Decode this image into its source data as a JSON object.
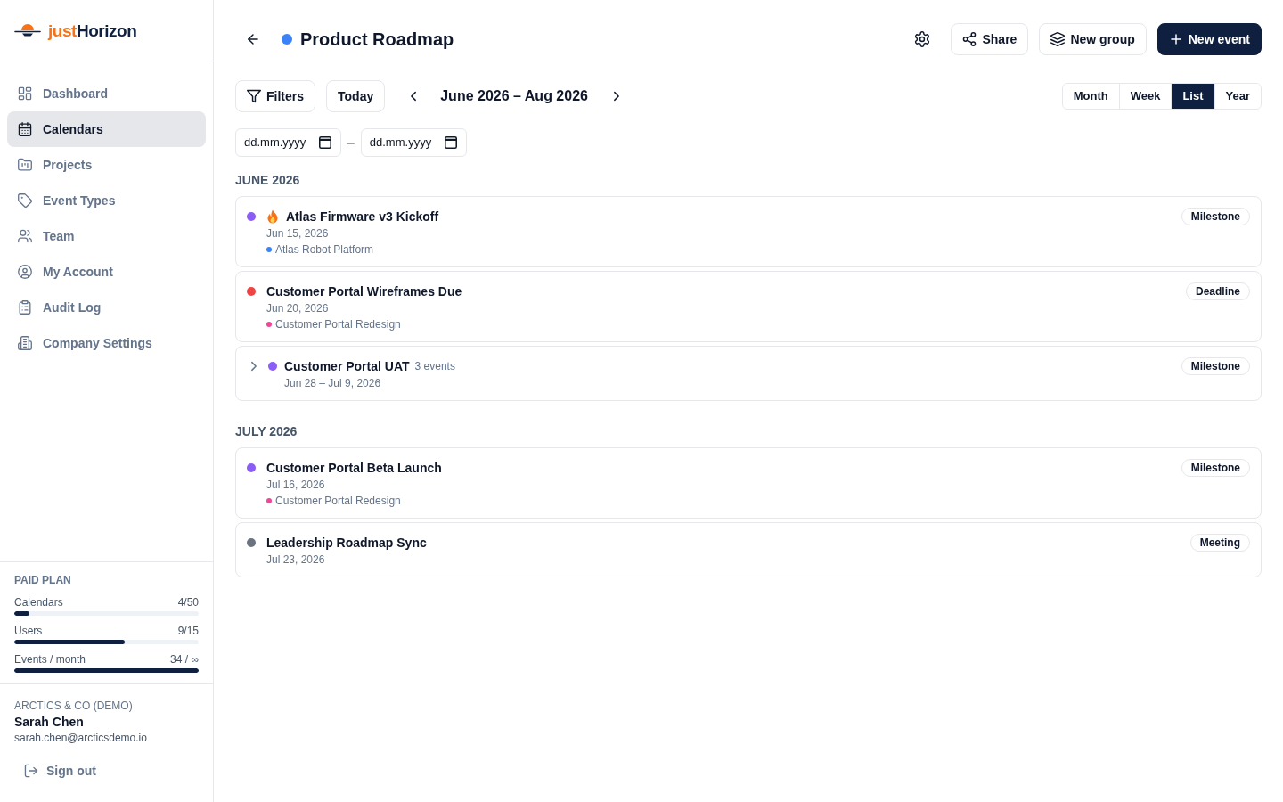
{
  "sidebar": {
    "logo": {
      "prefix": "just",
      "name": "Horizon"
    },
    "nav": [
      {
        "label": "Dashboard",
        "selected": false
      },
      {
        "label": "Calendars",
        "selected": true
      },
      {
        "label": "Projects",
        "selected": false
      },
      {
        "label": "Event Types",
        "selected": false
      },
      {
        "label": "Team",
        "selected": false
      },
      {
        "label": "My Account",
        "selected": false
      },
      {
        "label": "Audit Log",
        "selected": false
      },
      {
        "label": "Company Settings",
        "selected": false
      }
    ],
    "plan": {
      "title": "PAID PLAN",
      "meters": [
        {
          "label": "Calendars",
          "reading": "4/50",
          "level": 0.08
        },
        {
          "label": "Users",
          "reading": "9/15",
          "level": 0.6
        },
        {
          "label": "Events / month",
          "reading": "34 / ∞",
          "level": 1
        }
      ]
    },
    "account": {
      "organization": "ARCTICS & CO (DEMO)",
      "name": "Sarah Chen",
      "email": "sarah.chen@arcticsdemo.io",
      "sign_out": "Sign out"
    }
  },
  "header": {
    "title": "Product Roadmap",
    "buttons": [
      {
        "label": "Share",
        "primary": false
      },
      {
        "label": "New group",
        "primary": false
      },
      {
        "label": "New event",
        "primary": true
      }
    ]
  },
  "toolbar": {
    "filters": "Filters",
    "today": "Today",
    "range": "June 2026 – Aug 2026",
    "views": [
      {
        "label": "Month",
        "selected": false
      },
      {
        "label": "Week",
        "selected": false
      },
      {
        "label": "List",
        "selected": true
      },
      {
        "label": "Year",
        "selected": false
      }
    ]
  },
  "date_range": {
    "from": {
      "placeholder": "dd.mm.yyyy"
    },
    "separator": "–",
    "to": {
      "placeholder": "dd.mm.yyyy"
    }
  },
  "sections": [
    {
      "heading": "JUNE 2026",
      "events": [
        {
          "kind": "event",
          "title": "Atlas Firmware v3 Kickoff",
          "priority": true,
          "color": "#8b5cf6",
          "date": "Jun 15, 2026",
          "project": {
            "name": "Atlas Robot Platform",
            "color": "#3b82f6"
          },
          "badge": "Milestone"
        },
        {
          "kind": "event",
          "title": "Customer Portal Wireframes Due",
          "priority": false,
          "color": "#ef4444",
          "date": "Jun 20, 2026",
          "project": {
            "name": "Customer Portal Redesign",
            "color": "#ec4899"
          },
          "badge": "Deadline"
        },
        {
          "kind": "group",
          "title": "Customer Portal UAT",
          "priority": false,
          "expanded": false,
          "count": "3 events",
          "color": "#8b5cf6",
          "date": "Jun 28 – Jul 9, 2026",
          "badge": "Milestone"
        }
      ]
    },
    {
      "heading": "JULY 2026",
      "events": [
        {
          "kind": "event",
          "title": "Customer Portal Beta Launch",
          "priority": false,
          "color": "#8b5cf6",
          "date": "Jul 16, 2026",
          "project": {
            "name": "Customer Portal Redesign",
            "color": "#ec4899"
          },
          "badge": "Milestone"
        },
        {
          "kind": "event",
          "title": "Leadership Roadmap Sync",
          "priority": false,
          "color": "#6b7280",
          "date": "Jul 23, 2026",
          "badge": "Meeting"
        }
      ]
    }
  ]
}
